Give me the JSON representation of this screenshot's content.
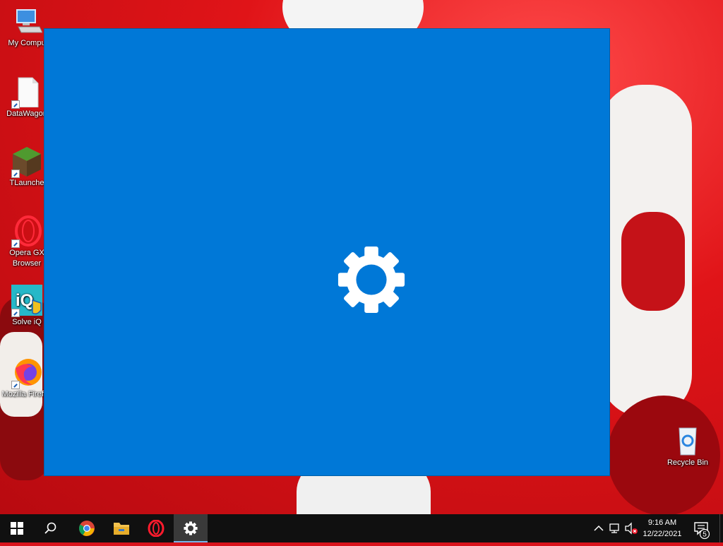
{
  "desktop": {
    "icons": [
      {
        "label": "My Compu",
        "icon": "computer-icon"
      },
      {
        "label": "DataWagon",
        "icon": "file-icon"
      },
      {
        "label": "TLaunche",
        "icon": "minecraft-icon"
      },
      {
        "label": "Opera GX Browser",
        "icon": "opera-gx-icon"
      },
      {
        "label": "Solve iQ",
        "icon": "solve-iq-icon"
      },
      {
        "label": "Mozilla Firefox",
        "icon": "firefox-icon"
      },
      {
        "label": "Recycle Bin",
        "icon": "recycle-bin-icon"
      }
    ]
  },
  "splash": {
    "background": "#0078d7",
    "icon": "gear-icon"
  },
  "taskbar": {
    "items": [
      {
        "name": "start",
        "icon": "windows-logo-icon"
      },
      {
        "name": "search",
        "icon": "search-icon"
      },
      {
        "name": "chrome",
        "icon": "chrome-icon"
      },
      {
        "name": "file-explorer",
        "icon": "folder-icon"
      },
      {
        "name": "opera",
        "icon": "opera-icon"
      },
      {
        "name": "settings",
        "icon": "gear-icon",
        "active": true
      }
    ],
    "tray": {
      "icons": [
        "chevron-up-icon",
        "network-icon",
        "volume-muted-icon"
      ],
      "time": "9:16 AM",
      "date": "12/22/2021",
      "notification_count": "5"
    }
  }
}
